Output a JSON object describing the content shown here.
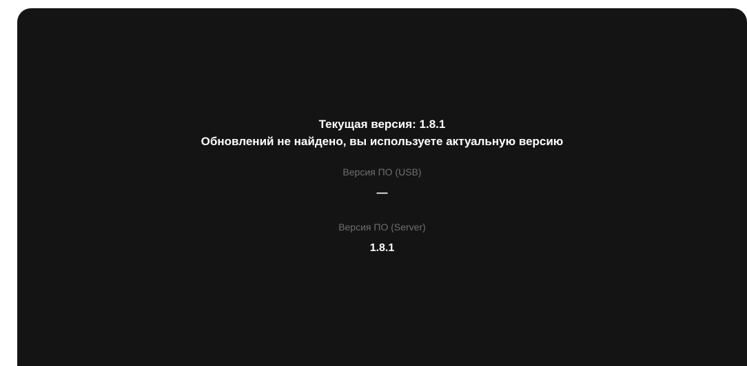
{
  "update": {
    "current_version_text": "Текущая версия: 1.8.1",
    "status_message": "Обновлений не найдено, вы используете актуальную версию"
  },
  "firmware": {
    "usb": {
      "label": "Версия ПО (USB)",
      "value": "—"
    },
    "server": {
      "label": "Версия ПО (Server)",
      "value": "1.8.1"
    }
  },
  "colors": {
    "panel_background": "#141414",
    "primary_text": "#ffffff",
    "secondary_text": "#6f6f6f"
  }
}
